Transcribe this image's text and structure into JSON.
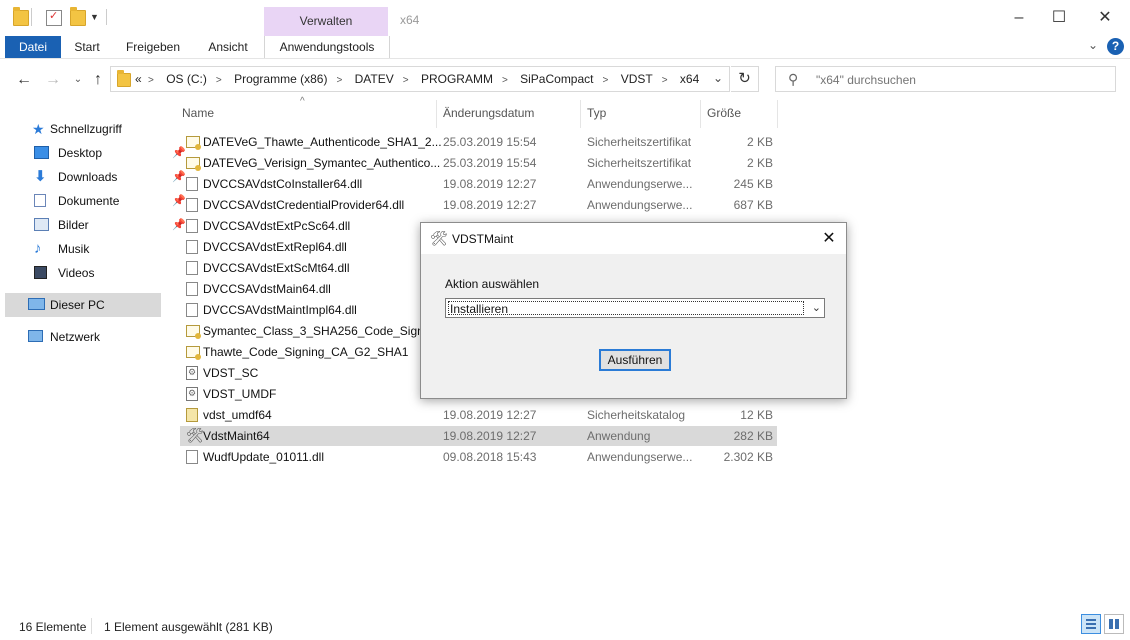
{
  "window": {
    "title": "x64",
    "contextual_tab_group": "Verwalten"
  },
  "ribbon": {
    "tabs": [
      "Datei",
      "Start",
      "Freigeben",
      "Ansicht",
      "Anwendungstools"
    ],
    "help_label": "?"
  },
  "address": {
    "breadcrumbs": [
      "OS (C:)",
      "Programme (x86)",
      "DATEV",
      "PROGRAMM",
      "SiPaCompact",
      "VDST",
      "x64"
    ],
    "overflow": "«"
  },
  "search": {
    "placeholder": "\"x64\" durchsuchen"
  },
  "sidebar": {
    "items": [
      {
        "label": "Schnellzugriff",
        "icon": "star-icon",
        "pinned": false
      },
      {
        "label": "Desktop",
        "icon": "desktop-icon",
        "pinned": true
      },
      {
        "label": "Downloads",
        "icon": "download-icon",
        "pinned": true
      },
      {
        "label": "Dokumente",
        "icon": "documents-icon",
        "pinned": true
      },
      {
        "label": "Bilder",
        "icon": "pictures-icon",
        "pinned": true
      },
      {
        "label": "Musik",
        "icon": "music-icon",
        "pinned": false
      },
      {
        "label": "Videos",
        "icon": "videos-icon",
        "pinned": false
      },
      {
        "label": "Dieser PC",
        "icon": "computer-icon",
        "pinned": false,
        "selected": true
      },
      {
        "label": "Netzwerk",
        "icon": "network-icon",
        "pinned": false
      }
    ]
  },
  "columns": {
    "name": "Name",
    "date": "Änderungsdatum",
    "type": "Typ",
    "size": "Größe"
  },
  "files": [
    {
      "name": "DATEVeG_Thawte_Authenticode_SHA1_2...",
      "date": "25.03.2019 15:54",
      "type": "Sicherheitszertifikat",
      "size": "2 KB",
      "icon": "cert"
    },
    {
      "name": "DATEVeG_Verisign_Symantec_Authentico...",
      "date": "25.03.2019 15:54",
      "type": "Sicherheitszertifikat",
      "size": "2 KB",
      "icon": "cert"
    },
    {
      "name": "DVCCSAVdstCoInstaller64.dll",
      "date": "19.08.2019 12:27",
      "type": "Anwendungserwe...",
      "size": "245 KB",
      "icon": "dll"
    },
    {
      "name": "DVCCSAVdstCredentialProvider64.dll",
      "date": "19.08.2019 12:27",
      "type": "Anwendungserwe...",
      "size": "687 KB",
      "icon": "dll"
    },
    {
      "name": "DVCCSAVdstExtPcSc64.dll",
      "date": "",
      "type": "",
      "size": "",
      "icon": "dll"
    },
    {
      "name": "DVCCSAVdstExtRepl64.dll",
      "date": "",
      "type": "",
      "size": "",
      "icon": "dll"
    },
    {
      "name": "DVCCSAVdstExtScMt64.dll",
      "date": "",
      "type": "",
      "size": "",
      "icon": "dll"
    },
    {
      "name": "DVCCSAVdstMain64.dll",
      "date": "",
      "type": "",
      "size": "",
      "icon": "dll"
    },
    {
      "name": "DVCCSAVdstMaintImpl64.dll",
      "date": "",
      "type": "",
      "size": "",
      "icon": "dll"
    },
    {
      "name": "Symantec_Class_3_SHA256_Code_Signin...",
      "date": "",
      "type": "",
      "size": "",
      "icon": "cert"
    },
    {
      "name": "Thawte_Code_Signing_CA_G2_SHA1",
      "date": "",
      "type": "",
      "size": "",
      "icon": "cert"
    },
    {
      "name": "VDST_SC",
      "date": "",
      "type": "",
      "size": "",
      "icon": "gear"
    },
    {
      "name": "VDST_UMDF",
      "date": "",
      "type": "",
      "size": "",
      "icon": "gear"
    },
    {
      "name": "vdst_umdf64",
      "date": "19.08.2019 12:27",
      "type": "Sicherheitskatalog",
      "size": "12 KB",
      "icon": "cat"
    },
    {
      "name": "VdstMaint64",
      "date": "19.08.2019 12:27",
      "type": "Anwendung",
      "size": "282 KB",
      "icon": "tool",
      "selected": true
    },
    {
      "name": "WudfUpdate_01011.dll",
      "date": "09.08.2018 15:43",
      "type": "Anwendungserwe...",
      "size": "2.302 KB",
      "icon": "dll"
    }
  ],
  "status": {
    "count": "16 Elemente",
    "selection": "1 Element ausgewählt (281 KB)"
  },
  "dialog": {
    "title": "VDSTMaint",
    "label": "Aktion auswählen",
    "selected_option": "Installieren",
    "button": "Ausführen"
  },
  "colors": {
    "accent": "#1a61b3",
    "context_tab": "#e9d5f5",
    "selection": "#d9d9d9"
  }
}
